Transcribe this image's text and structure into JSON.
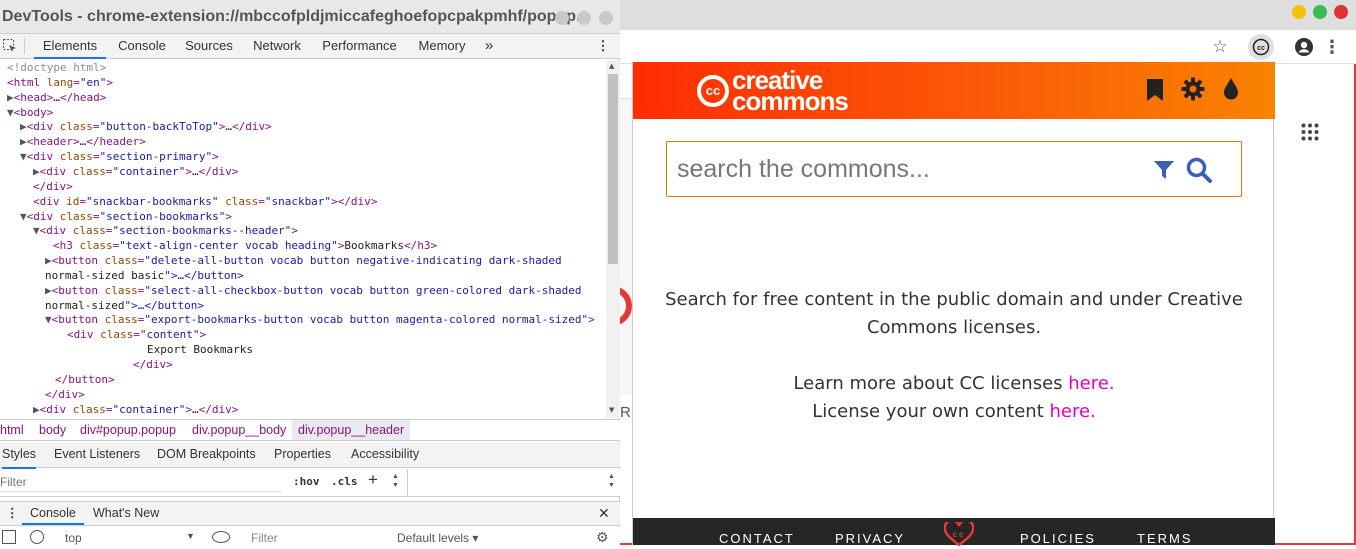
{
  "devtools": {
    "title": "DevTools - chrome-extension://mbccofpldjmiccafeghoefopcpakpmhf/popup...",
    "tabs": [
      "Elements",
      "Console",
      "Sources",
      "Network",
      "Performance",
      "Memory"
    ],
    "more_tabs_icon": "double-chevron-right",
    "dom_lines": [
      {
        "t": "cmt",
        "s": "<!doctype html>"
      },
      {
        "t": "raw",
        "s": "<html lang=\"en\">"
      },
      {
        "t": "raw",
        "s": "▶<head>…</head>"
      },
      {
        "t": "raw",
        "s": "▼<body>"
      },
      {
        "t": "raw",
        "s": "▶<div class=\"button-backToTop\">…</div>"
      },
      {
        "t": "raw",
        "s": "▶<header>…</header>"
      },
      {
        "t": "raw",
        "s": "▼<div class=\"section-primary\">"
      },
      {
        "t": "raw",
        "s": "▶<div class=\"container\">…</div>"
      },
      {
        "t": "raw",
        "s": "</div>"
      },
      {
        "t": "raw",
        "s": "<div id=\"snackbar-bookmarks\" class=\"snackbar\"></div>"
      },
      {
        "t": "raw",
        "s": "▼<div class=\"section-bookmarks\">"
      },
      {
        "t": "raw",
        "s": "▼<div class=\"section-bookmarks--header\">"
      },
      {
        "t": "raw",
        "s": "<h3 class=\"text-align-center vocab heading\">Bookmarks</h3>"
      },
      {
        "t": "raw",
        "s": "▶<button class=\"delete-all-button vocab button negative-indicating dark-shaded"
      },
      {
        "t": "raw",
        "s": "normal-sized basic\">…</button>"
      },
      {
        "t": "raw",
        "s": "▶<button class=\"select-all-checkbox-button vocab button green-colored dark-shaded"
      },
      {
        "t": "raw",
        "s": "normal-sized\">…</button>"
      },
      {
        "t": "raw",
        "s": "▼<button class=\"export-bookmarks-button vocab button magenta-colored normal-sized\">"
      },
      {
        "t": "raw",
        "s": "<div class=\"content\">"
      },
      {
        "t": "raw",
        "s": "Export Bookmarks"
      },
      {
        "t": "raw",
        "s": "</div>"
      },
      {
        "t": "raw",
        "s": "</button>"
      },
      {
        "t": "raw",
        "s": "</div>"
      },
      {
        "t": "raw",
        "s": "▶<div class=\"container\">…</div>"
      }
    ],
    "breadcrumbs": [
      "html",
      "body",
      "div#popup.popup",
      "div.popup__body",
      "div.popup__header"
    ],
    "styles_tabs": [
      "Styles",
      "Event Listeners",
      "DOM Breakpoints",
      "Properties",
      "Accessibility"
    ],
    "filter_placeholder": "Filter",
    "hov_label": ":hov",
    "cls_label": ".cls",
    "plus_label": "+",
    "drawer_tabs": [
      "Console",
      "What's New"
    ],
    "console_context": "top",
    "console_filter_placeholder": "Filter",
    "default_levels": "Default levels ▾"
  },
  "popup": {
    "logo_cc": "cc",
    "logo_line1": "creative",
    "logo_line2": "commons",
    "search_placeholder": "search the commons...",
    "info_line1": "Search for free content in the public domain and under Creative",
    "info_line2": "Commons licenses.",
    "learn_text": "Learn more about CC licenses ",
    "learn_link": "here.",
    "license_text": "License your own content ",
    "license_link": "here.",
    "footer": [
      "CONTACT",
      "PRIVACY",
      "POLICIES",
      "TERMS"
    ],
    "colors": {
      "header_start": "#ff2d00",
      "header_end": "#f98300",
      "link": "#e300c0",
      "search_border": "#e07b00",
      "filter_icon": "#3c5db8"
    }
  },
  "browser": {
    "window_controls": [
      "minimize",
      "maximize",
      "close"
    ],
    "toolbar_icons": [
      "star-icon",
      "cc-extension-icon",
      "account-icon",
      "menu-kebab-icon"
    ],
    "partial_text": "RL"
  }
}
